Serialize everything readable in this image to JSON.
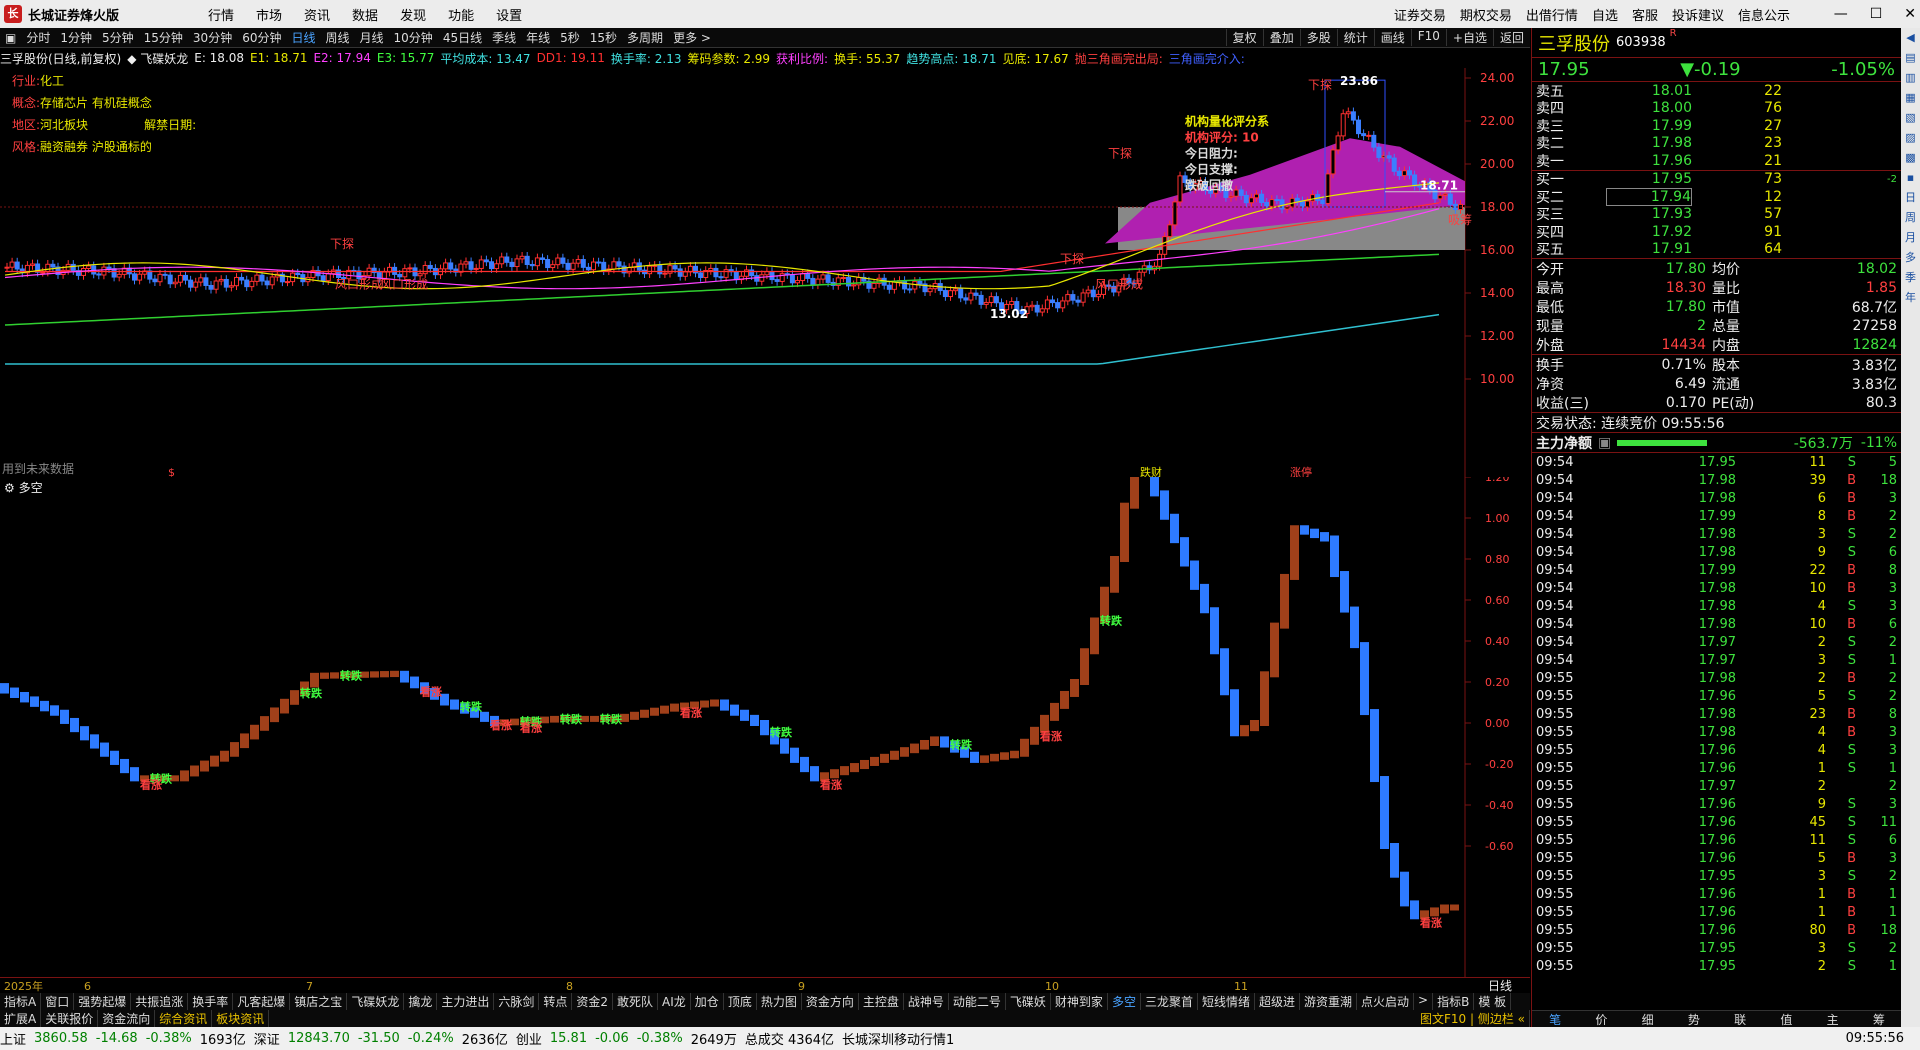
{
  "titlebar": {
    "app_name": "长城证券烽火版",
    "menus": [
      "行情",
      "市场",
      "资讯",
      "数据",
      "发现",
      "功能",
      "设置"
    ],
    "right_menus": [
      "证券交易",
      "期权交易",
      "出借行情",
      "自选",
      "客服",
      "投诉建议",
      "信息公示"
    ]
  },
  "periods": [
    "分时",
    "1分钟",
    "5分钟",
    "15分钟",
    "30分钟",
    "60分钟",
    "日线",
    "周线",
    "月线",
    "10分钟",
    "45日线",
    "季线",
    "年线",
    "5秒",
    "15秒",
    "多周期",
    "更多 >"
  ],
  "active_period": "日线",
  "tools": [
    "复权",
    "叠加",
    "多股",
    "统计",
    "画线",
    "F10",
    "+自选",
    "返回"
  ],
  "infoline": [
    {
      "t": "三孚股份(日线,前复权)",
      "c": "#eee"
    },
    {
      "t": "◆ 飞碟妖龙",
      "c": "#eee"
    },
    {
      "t": "E: 18.08",
      "c": "#eee"
    },
    {
      "t": "E1: 18.71",
      "c": "#E8E800"
    },
    {
      "t": "E2: 17.94",
      "c": "#FF40FF"
    },
    {
      "t": "E3: 15.77",
      "c": "#40FF40"
    },
    {
      "t": "平均成本: 13.47",
      "c": "#40E0E0"
    },
    {
      "t": "DD1: 19.11",
      "c": "#FF3030"
    },
    {
      "t": "换手率: 2.13",
      "c": "#40E0E0"
    },
    {
      "t": "筹码参数: 2.99",
      "c": "#E8E800"
    },
    {
      "t": "获利比例:",
      "c": "#FF40FF"
    },
    {
      "t": "换手: 55.37",
      "c": "#E8E800"
    },
    {
      "t": "趋势高点: 18.71",
      "c": "#40E0E0"
    },
    {
      "t": "见底: 17.67",
      "c": "#E8E800"
    },
    {
      "t": "抛三角画完出局:",
      "c": "#FF4040"
    },
    {
      "t": "三角画完介入:",
      "c": "#4060FF"
    }
  ],
  "stock_info": {
    "industry_label": "行业:",
    "industry": "化工",
    "concept_label": "概念:",
    "concept": "存储芯片 有机硅概念",
    "region_label": "地区:",
    "region": "河北板块",
    "unlock_label": "解禁日期:",
    "style_label": "风格:",
    "style": "融资融券 沪股通标的"
  },
  "main_chart": {
    "y_ticks": [
      "24.00",
      "22.00",
      "20.00",
      "18.00",
      "16.00",
      "14.00",
      "12.00",
      "10.00"
    ],
    "hi_label": "23.86",
    "lo_label": "13.02",
    "cur_label": "18.71",
    "future_data_label": "用到未来数据",
    "annotations": [
      "风口形成",
      "风口形成",
      "风口形成",
      "下探",
      "下探",
      "下探",
      "下探",
      "吸筹"
    ],
    "inst_panel": [
      "机构量化评分系",
      "机构评分: 10",
      "今日阻力:",
      "今日支撑:",
      "跌破回撤"
    ],
    "bottom_marks": [
      "$",
      "跌财",
      "涨停"
    ]
  },
  "indicator": {
    "title": "多空",
    "y_ticks": [
      "1.20",
      "1.00",
      "0.80",
      "0.60",
      "0.40",
      "0.20",
      "0.00",
      "-0.20",
      "-0.40",
      "-0.60"
    ],
    "labels_up": "看涨",
    "labels_down": "转跌"
  },
  "xaxis": {
    "labels": [
      "2025年",
      "6",
      "7",
      "8",
      "9",
      "10",
      "11"
    ],
    "right": "日线"
  },
  "tabs1": [
    "指标A",
    "窗口",
    "强势起爆",
    "共振追涨",
    "换手率",
    "凡客起爆",
    "镇店之宝",
    "飞碟妖龙",
    "擒龙",
    "主力进出",
    "六脉剑",
    "转点",
    "资金2",
    "敢死队",
    "AI龙",
    "加仓",
    "顶底",
    "热力图",
    "资金方向",
    "主控盘",
    "战神号",
    "动能二号",
    "飞碟妖",
    "财神到家",
    "多空",
    "三龙聚首",
    "短线情绪",
    "超级进",
    "游资重潮",
    "点火启动",
    ">",
    "指标B",
    "模 板"
  ],
  "active_tab1": "多空",
  "tabs2": [
    "扩展A",
    "关联报价",
    "资金流向",
    "综合资讯",
    "板块资讯"
  ],
  "tabs2_right": "图文F10 | 侧边栏 «",
  "statusbar": {
    "sh": {
      "name": "上证",
      "val": "3860.58",
      "chg": "-14.68",
      "pct": "-0.38%",
      "amt": "1693亿"
    },
    "sz": {
      "name": "深证",
      "val": "12843.70",
      "chg": "-31.50",
      "pct": "-0.24%",
      "amt": "2636亿"
    },
    "cy": {
      "name": "创业",
      "val": "15.81",
      "chg": "-0.06",
      "pct": "-0.38%",
      "amt": "2649万"
    },
    "total": "总成交 4364亿",
    "feed": "长城深圳移动行情1",
    "time": "09:55:56"
  },
  "quote": {
    "name": "三孚股份",
    "code": "603938",
    "tag": "R",
    "price": "17.95",
    "change": "▼-0.19",
    "pct": "-1.05%",
    "asks": [
      {
        "l": "卖五",
        "p": "18.01",
        "v": "22"
      },
      {
        "l": "卖四",
        "p": "18.00",
        "v": "76"
      },
      {
        "l": "卖三",
        "p": "17.99",
        "v": "27"
      },
      {
        "l": "卖二",
        "p": "17.98",
        "v": "23"
      },
      {
        "l": "卖一",
        "p": "17.96",
        "v": "21"
      }
    ],
    "bids": [
      {
        "l": "买一",
        "p": "17.95",
        "v": "73",
        "c": "-2"
      },
      {
        "l": "买二",
        "p": "17.94",
        "v": "12",
        "c": ""
      },
      {
        "l": "买三",
        "p": "17.93",
        "v": "57",
        "c": ""
      },
      {
        "l": "买四",
        "p": "17.92",
        "v": "91",
        "c": ""
      },
      {
        "l": "买五",
        "p": "17.91",
        "v": "64",
        "c": ""
      }
    ],
    "stats": [
      {
        "k1": "今开",
        "v1": "17.80",
        "c1": "g",
        "k2": "均价",
        "v2": "18.02",
        "c2": "g"
      },
      {
        "k1": "最高",
        "v1": "18.30",
        "c1": "r",
        "k2": "量比",
        "v2": "1.85",
        "c2": "r"
      },
      {
        "k1": "最低",
        "v1": "17.80",
        "c1": "g",
        "k2": "市值",
        "v2": "68.7亿",
        "c2": "w"
      },
      {
        "k1": "现量",
        "v1": "2",
        "c1": "g",
        "k2": "总量",
        "v2": "27258",
        "c2": "w"
      },
      {
        "k1": "外盘",
        "v1": "14434",
        "c1": "r",
        "k2": "内盘",
        "v2": "12824",
        "c2": "g"
      }
    ],
    "stats2": [
      {
        "k1": "换手",
        "v1": "0.71%",
        "k2": "股本",
        "v2": "3.83亿"
      },
      {
        "k1": "净资",
        "v1": "6.49",
        "k2": "流通",
        "v2": "3.83亿"
      },
      {
        "k1": "收益(三)",
        "v1": "0.170",
        "k2": "PE(动)",
        "v2": "80.3"
      }
    ],
    "trade_state": "交易状态: 连续竞价 09:55:56",
    "main_flow_label": "主力净额",
    "main_flow_val": "-563.7万",
    "main_flow_pct": "-11%"
  },
  "trades": [
    {
      "t": "09:54",
      "p": "17.95",
      "v": "11",
      "s": "S",
      "n": "5"
    },
    {
      "t": "09:54",
      "p": "17.98",
      "v": "39",
      "s": "B",
      "n": "18"
    },
    {
      "t": "09:54",
      "p": "17.98",
      "v": "6",
      "s": "B",
      "n": "3"
    },
    {
      "t": "09:54",
      "p": "17.99",
      "v": "8",
      "s": "B",
      "n": "2"
    },
    {
      "t": "09:54",
      "p": "17.98",
      "v": "3",
      "s": "S",
      "n": "2"
    },
    {
      "t": "09:54",
      "p": "17.98",
      "v": "9",
      "s": "S",
      "n": "6"
    },
    {
      "t": "09:54",
      "p": "17.99",
      "v": "22",
      "s": "B",
      "n": "8"
    },
    {
      "t": "09:54",
      "p": "17.98",
      "v": "10",
      "s": "B",
      "n": "3"
    },
    {
      "t": "09:54",
      "p": "17.98",
      "v": "4",
      "s": "S",
      "n": "3"
    },
    {
      "t": "09:54",
      "p": "17.98",
      "v": "10",
      "s": "B",
      "n": "6"
    },
    {
      "t": "09:54",
      "p": "17.97",
      "v": "2",
      "s": "S",
      "n": "2"
    },
    {
      "t": "09:54",
      "p": "17.97",
      "v": "3",
      "s": "S",
      "n": "1"
    },
    {
      "t": "09:55",
      "p": "17.98",
      "v": "2",
      "s": "B",
      "n": "2"
    },
    {
      "t": "09:55",
      "p": "17.96",
      "v": "5",
      "s": "S",
      "n": "2"
    },
    {
      "t": "09:55",
      "p": "17.98",
      "v": "23",
      "s": "B",
      "n": "8"
    },
    {
      "t": "09:55",
      "p": "17.98",
      "v": "4",
      "s": "B",
      "n": "3"
    },
    {
      "t": "09:55",
      "p": "17.96",
      "v": "4",
      "s": "S",
      "n": "3"
    },
    {
      "t": "09:55",
      "p": "17.96",
      "v": "1",
      "s": "S",
      "n": "1"
    },
    {
      "t": "09:55",
      "p": "17.97",
      "v": "2",
      "s": "",
      "n": "2"
    },
    {
      "t": "09:55",
      "p": "17.96",
      "v": "9",
      "s": "S",
      "n": "3"
    },
    {
      "t": "09:55",
      "p": "17.96",
      "v": "45",
      "s": "S",
      "n": "11"
    },
    {
      "t": "09:55",
      "p": "17.96",
      "v": "11",
      "s": "S",
      "n": "6"
    },
    {
      "t": "09:55",
      "p": "17.96",
      "v": "5",
      "s": "B",
      "n": "3"
    },
    {
      "t": "09:55",
      "p": "17.95",
      "v": "3",
      "s": "S",
      "n": "2"
    },
    {
      "t": "09:55",
      "p": "17.96",
      "v": "1",
      "s": "B",
      "n": "1"
    },
    {
      "t": "09:55",
      "p": "17.96",
      "v": "1",
      "s": "B",
      "n": "1"
    },
    {
      "t": "09:55",
      "p": "17.96",
      "v": "80",
      "s": "B",
      "n": "18"
    },
    {
      "t": "09:55",
      "p": "17.95",
      "v": "3",
      "s": "S",
      "n": "2"
    },
    {
      "t": "09:55",
      "p": "17.95",
      "v": "2",
      "s": "S",
      "n": "1"
    }
  ],
  "rp_tabs": [
    "笔",
    "价",
    "细",
    "势",
    "联",
    "值",
    "主",
    "筹"
  ],
  "side_tools": [
    "◀",
    "▤",
    "▥",
    "▦",
    "▧",
    "▨",
    "▩",
    "▪",
    "日",
    "周",
    "月",
    "多",
    "季",
    "年"
  ]
}
